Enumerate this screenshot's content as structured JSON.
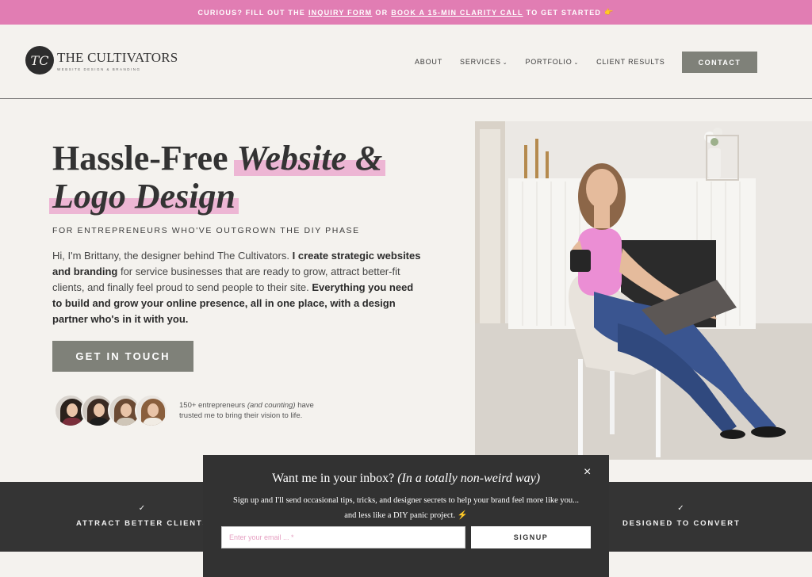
{
  "banner": {
    "prefix": "CURIOUS? FILL OUT THE",
    "link1": "INQUIRY FORM",
    "middle": "OR",
    "link2": "BOOK A 15-MIN CLARITY CALL",
    "suffix": "TO GET STARTED",
    "emoji": "👉"
  },
  "logo": {
    "mark": "TC",
    "name": "THE CULTIVATORS",
    "sub": "WEBSITE DESIGN & BRANDING"
  },
  "nav": {
    "about": "ABOUT",
    "services": "SERVICES",
    "portfolio": "PORTFOLIO",
    "client_results": "CLIENT RESULTS",
    "contact": "CONTACT"
  },
  "hero": {
    "title_plain": "Hassle-Free",
    "title_italic1": "Website &",
    "title_italic2": "Logo Design",
    "tagline": "FOR ENTREPRENEURS WHO'VE OUTGROWN THE DIY PHASE",
    "intro_a": "Hi, I'm Brittany, the designer behind The Cultivators.",
    "intro_b": "I create strategic websites and branding",
    "intro_c": "for service businesses that are ready to grow, attract better-fit clients, and finally feel proud to send people to their site.",
    "intro_d": "Everything you need to build and grow your online presence, all in one place, with a design partner who's in it with you.",
    "cta": "GET IN TOUCH",
    "social_a": "150+ entrepreneurs",
    "social_b": "(and counting)",
    "social_c": "have trusted me to bring their vision to life."
  },
  "features": {
    "left": "ATTRACT BETTER CLIENTS",
    "right": "DESIGNED TO CONVERT",
    "check": "✓"
  },
  "popup": {
    "title_a": "Want me in your inbox?",
    "title_b": "(In a totally non-weird way)",
    "close": "×",
    "body_a": "Sign up and I'll send occasional tips, tricks, and designer secrets to help your brand feel more like you...",
    "body_b": "and less like a DIY panic project.",
    "bolt": "⚡",
    "email_placeholder": "Enter your email ... *",
    "signup": "SIGNUP"
  },
  "colors": {
    "banner": "#e17db3",
    "highlight": "#edb6d4",
    "button": "#7f8179",
    "dark": "#343434",
    "background": "#f4f2ee"
  }
}
